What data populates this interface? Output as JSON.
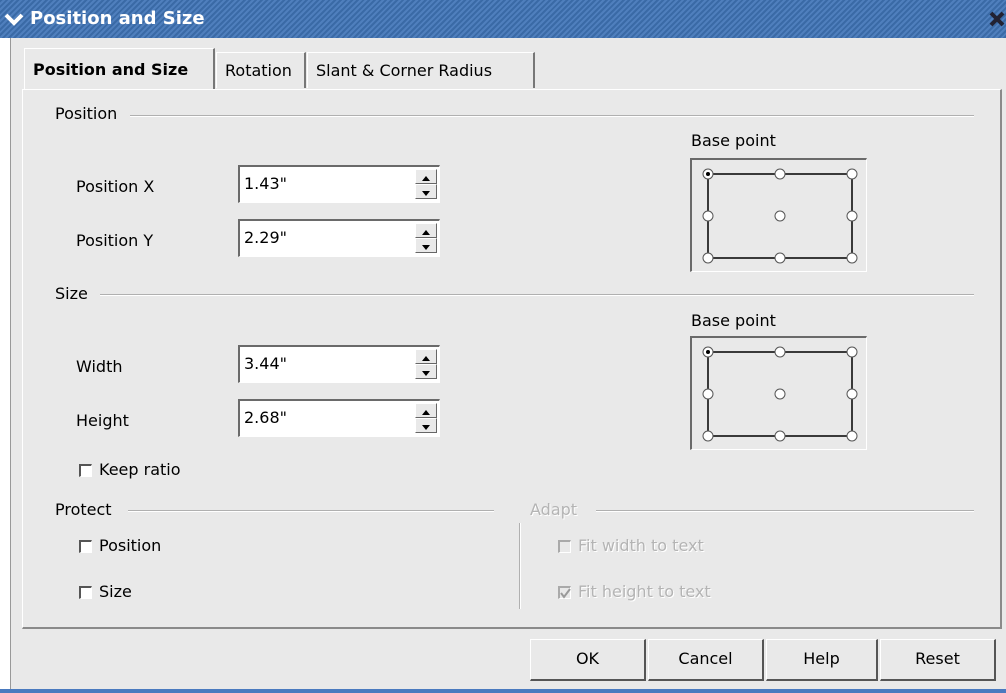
{
  "window": {
    "title": "Position and Size"
  },
  "tabs": [
    {
      "label": "Position and Size"
    },
    {
      "label": "Rotation"
    },
    {
      "label": "Slant & Corner Radius"
    }
  ],
  "position": {
    "heading": "Position",
    "x_label": "Position X",
    "x_value": "1.43\"",
    "y_label": "Position Y",
    "y_value": "2.29\"",
    "base_point_label": "Base point"
  },
  "size": {
    "heading": "Size",
    "width_label": "Width",
    "width_value": "3.44\"",
    "height_label": "Height",
    "height_value": "2.68\"",
    "keep_ratio_label": "Keep ratio",
    "keep_ratio_checked": false,
    "base_point_label": "Base point"
  },
  "protect": {
    "heading": "Protect",
    "position_label": "Position",
    "position_checked": false,
    "size_label": "Size",
    "size_checked": false
  },
  "adapt": {
    "heading": "Adapt",
    "fit_width_label": "Fit width to text",
    "fit_width_checked": false,
    "fit_height_label": "Fit height to text",
    "fit_height_checked": true
  },
  "buttons": {
    "ok": "OK",
    "cancel": "Cancel",
    "help": "Help",
    "reset": "Reset"
  },
  "colors": {
    "titlebar": "#3a6aa6",
    "dialog_bg": "#e9e9e9"
  },
  "icons": {
    "collapse": "chevron-down-icon",
    "close": "close-icon"
  }
}
